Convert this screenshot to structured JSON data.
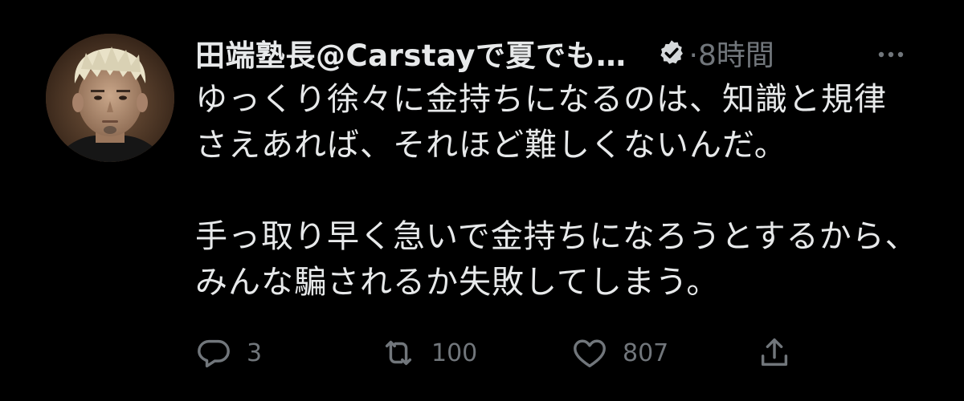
{
  "tweet": {
    "display_name": "田端塾長@Carstayで夏でも…",
    "time_label": "·8時間",
    "body": [
      "ゆっくり徐々に金持ちになるのは、知識と規律さえあれば、それほど難しくないんだ。",
      "手っ取り早く急いで金持ちになろうとするから、みんな騙されるか失敗してしまう。"
    ],
    "actions": {
      "reply_count": "3",
      "retweet_count": "100",
      "like_count": "807"
    },
    "icons": {
      "verified": "verified-badge-icon",
      "more": "more-icon",
      "reply": "reply-icon",
      "retweet": "retweet-icon",
      "like": "heart-icon",
      "share": "share-icon"
    },
    "colors": {
      "background": "#000000",
      "text": "#e7e9ea",
      "secondary": "#71767b"
    }
  }
}
